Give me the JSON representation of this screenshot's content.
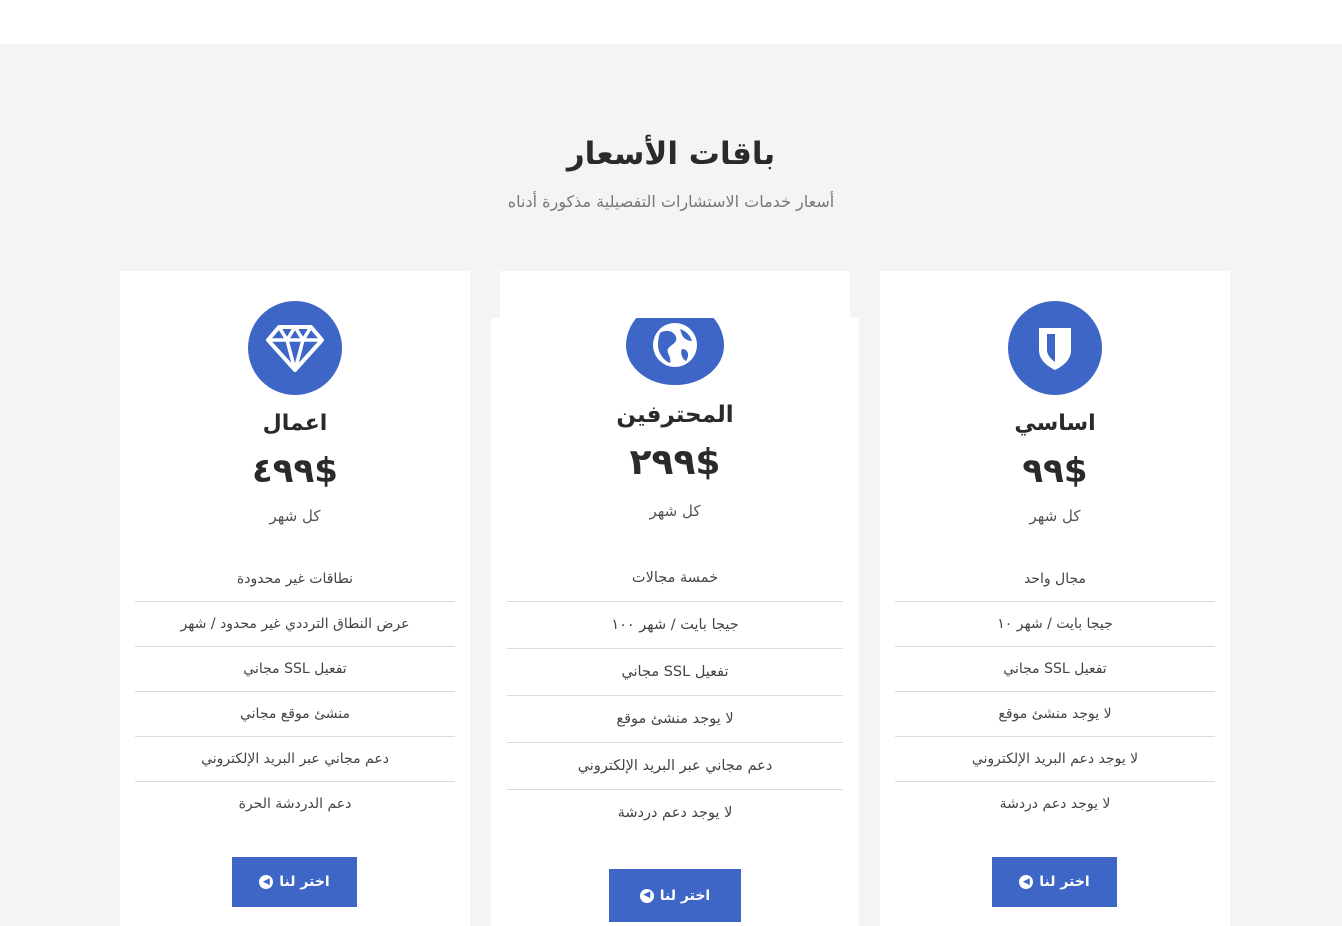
{
  "header": {
    "title": "باقات الأسعار",
    "subtitle": "أسعار خدمات الاستشارات التفصيلية مذكورة أدناه"
  },
  "colors": {
    "accent": "#3d66c7",
    "background": "#f4f4f4",
    "card": "#ffffff"
  },
  "plans": [
    {
      "icon": "shield-icon",
      "name": "اساسي",
      "price": "٩٩$",
      "period": "كل شهر",
      "features": [
        "مجال واحد",
        "جيجا بايت / شهر ١٠",
        "تفعيل SSL مجاني",
        "لا يوجد منشئ موقع",
        "لا يوجد دعم البريد الإلكتروني",
        "لا يوجد دعم دردشة"
      ],
      "button": "اختر لنا"
    },
    {
      "icon": "globe-icon",
      "name": "المحترفين",
      "price": "٢٩٩$",
      "period": "كل شهر",
      "features": [
        "خمسة مجالات",
        "جيجا بايت / شهر ١٠٠",
        "تفعيل SSL مجاني",
        "لا يوجد منشئ موقع",
        "دعم مجاني عبر البريد الإلكتروني",
        "لا يوجد دعم دردشة"
      ],
      "button": "اختر لنا"
    },
    {
      "icon": "diamond-icon",
      "name": "اعمال",
      "price": "٤٩٩$",
      "period": "كل شهر",
      "features": [
        "نطاقات غير محدودة",
        "عرض النطاق الترددي غير محدود / شهر",
        "تفعيل SSL مجاني",
        "منشئ موقع مجاني",
        "دعم مجاني عبر البريد الإلكتروني",
        "دعم الدردشة الحرة"
      ],
      "button": "اختر لنا"
    }
  ]
}
